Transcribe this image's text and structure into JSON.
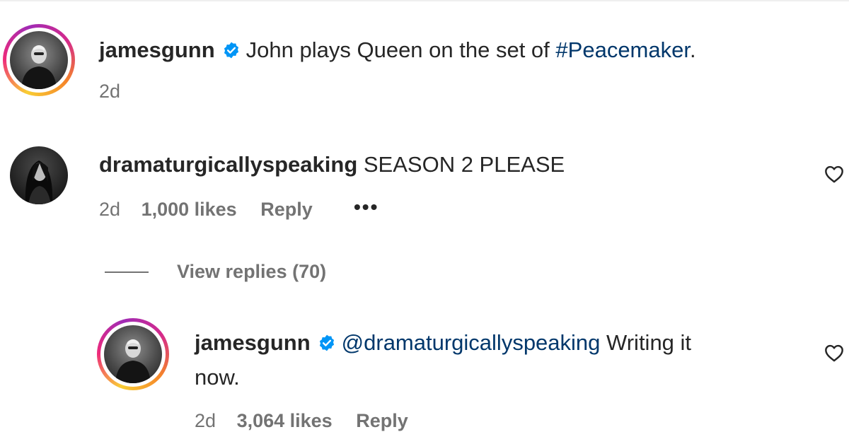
{
  "post": {
    "username": "jamesgunn",
    "text_prefix": "John plays Queen on the set of",
    "hashtag": "#Peacemaker",
    "text_suffix": ".",
    "time": "2d"
  },
  "comment": {
    "username": "dramaturgicallyspeaking",
    "text": "SEASON 2 PLEASE",
    "time": "2d",
    "likes": "1,000 likes",
    "reply_label": "Reply",
    "more_label": "•••"
  },
  "view_replies": "View replies (70)",
  "reply": {
    "username": "jamesgunn",
    "mention": "@dramaturgicallyspeaking",
    "text_line1": "Writing it",
    "text_line2": "now.",
    "time": "2d",
    "likes": "3,064 likes",
    "reply_label": "Reply"
  },
  "icons": {
    "verified": "verified-badge-icon",
    "like": "heart-outline-icon",
    "more": "more-options-icon"
  },
  "colors": {
    "verified_blue": "#0095f6",
    "link_blue": "#00376b",
    "meta_gray": "#737373"
  }
}
